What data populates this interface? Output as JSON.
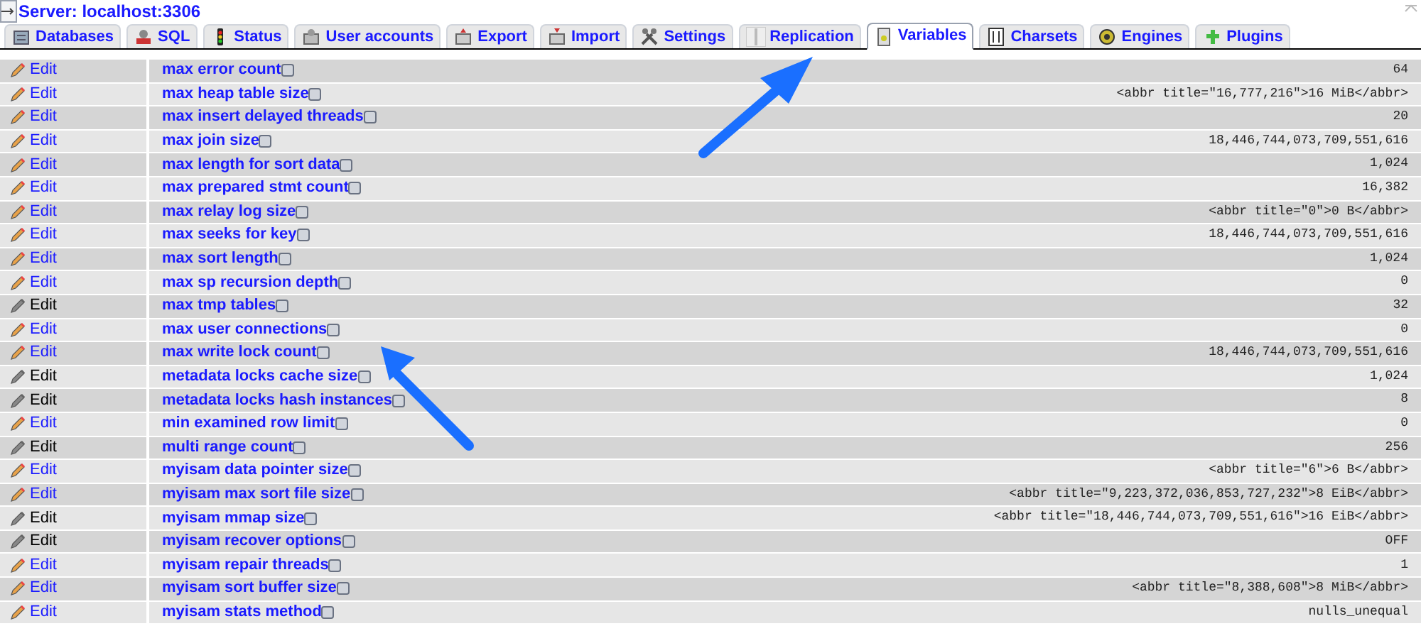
{
  "header": {
    "title": "Server: localhost:3306"
  },
  "tabs": [
    {
      "label": "Databases",
      "selected": false
    },
    {
      "label": "SQL",
      "selected": false
    },
    {
      "label": "Status",
      "selected": false
    },
    {
      "label": "User accounts",
      "selected": false
    },
    {
      "label": "Export",
      "selected": false
    },
    {
      "label": "Import",
      "selected": false
    },
    {
      "label": "Settings",
      "selected": false
    },
    {
      "label": "Replication",
      "selected": false
    },
    {
      "label": "Variables",
      "selected": true
    },
    {
      "label": "Charsets",
      "selected": false
    },
    {
      "label": "Engines",
      "selected": false
    },
    {
      "label": "Plugins",
      "selected": false
    }
  ],
  "rows": [
    {
      "action": "Edit",
      "editable": true,
      "name": "max error count",
      "value": "64"
    },
    {
      "action": "Edit",
      "editable": true,
      "name": "max heap table size",
      "value": "<abbr title=\"16,777,216\">16 MiB</abbr>"
    },
    {
      "action": "Edit",
      "editable": true,
      "name": "max insert delayed threads",
      "value": "20"
    },
    {
      "action": "Edit",
      "editable": true,
      "name": "max join size",
      "value": "18,446,744,073,709,551,616"
    },
    {
      "action": "Edit",
      "editable": true,
      "name": "max length for sort data",
      "value": "1,024"
    },
    {
      "action": "Edit",
      "editable": true,
      "name": "max prepared stmt count",
      "value": "16,382"
    },
    {
      "action": "Edit",
      "editable": true,
      "name": "max relay log size",
      "value": "<abbr title=\"0\">0 B</abbr>"
    },
    {
      "action": "Edit",
      "editable": true,
      "name": "max seeks for key",
      "value": "18,446,744,073,709,551,616"
    },
    {
      "action": "Edit",
      "editable": true,
      "name": "max sort length",
      "value": "1,024"
    },
    {
      "action": "Edit",
      "editable": true,
      "name": "max sp recursion depth",
      "value": "0"
    },
    {
      "action": "Edit",
      "editable": false,
      "name": "max tmp tables",
      "value": "32"
    },
    {
      "action": "Edit",
      "editable": true,
      "name": "max user connections",
      "value": "0"
    },
    {
      "action": "Edit",
      "editable": true,
      "name": "max write lock count",
      "value": "18,446,744,073,709,551,616"
    },
    {
      "action": "Edit",
      "editable": false,
      "name": "metadata locks cache size",
      "value": "1,024"
    },
    {
      "action": "Edit",
      "editable": false,
      "name": "metadata locks hash instances",
      "value": "8"
    },
    {
      "action": "Edit",
      "editable": true,
      "name": "min examined row limit",
      "value": "0"
    },
    {
      "action": "Edit",
      "editable": false,
      "name": "multi range count",
      "value": "256"
    },
    {
      "action": "Edit",
      "editable": true,
      "name": "myisam data pointer size",
      "value": "<abbr title=\"6\">6 B</abbr>"
    },
    {
      "action": "Edit",
      "editable": true,
      "name": "myisam max sort file size",
      "value": "<abbr title=\"9,223,372,036,853,727,232\">8 EiB</abbr>"
    },
    {
      "action": "Edit",
      "editable": false,
      "name": "myisam mmap size",
      "value": "<abbr title=\"18,446,744,073,709,551,616\">16 EiB</abbr>"
    },
    {
      "action": "Edit",
      "editable": false,
      "name": "myisam recover options",
      "value": "OFF"
    },
    {
      "action": "Edit",
      "editable": true,
      "name": "myisam repair threads",
      "value": "1"
    },
    {
      "action": "Edit",
      "editable": true,
      "name": "myisam sort buffer size",
      "value": "<abbr title=\"8,388,608\">8 MiB</abbr>"
    },
    {
      "action": "Edit",
      "editable": true,
      "name": "myisam stats method",
      "value": "nulls_unequal"
    }
  ]
}
